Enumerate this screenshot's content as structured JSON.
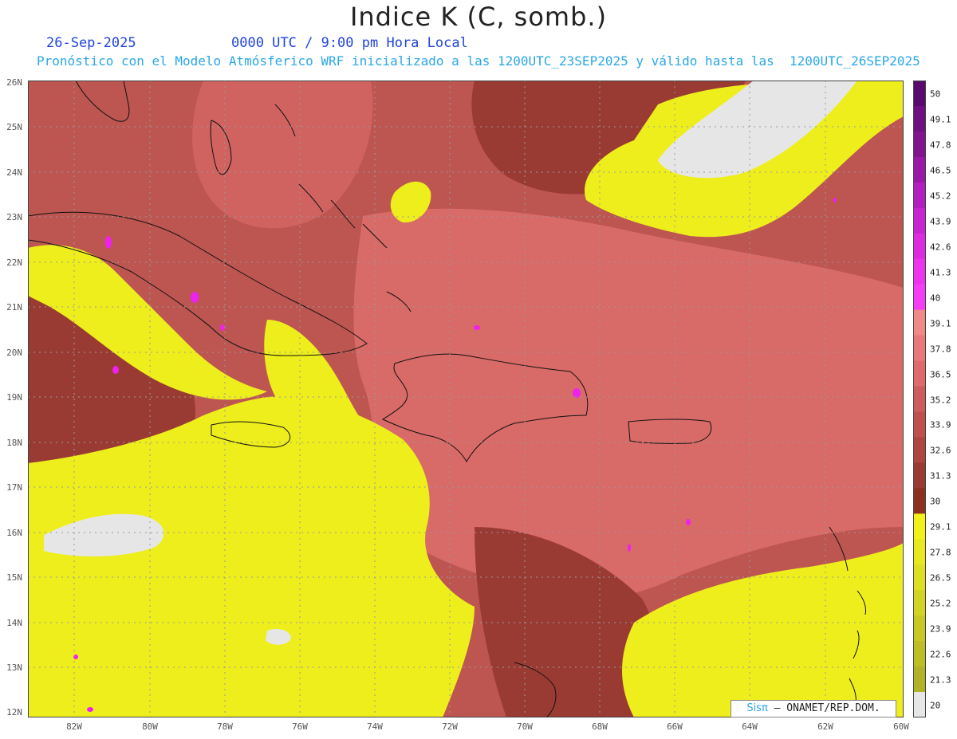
{
  "title": "Indice K (C, somb.)",
  "date_label": "26-Sep-2025",
  "time_label": "0000 UTC / 9:00 pm Hora Local",
  "description": "Pronóstico con el Modelo Atmósferico WRF inicializado a las 1200UTC_23SEP2025 y válido hasta las  1200UTC_26SEP2025",
  "y_axis_labels": [
    "26N",
    "25N",
    "24N",
    "23N",
    "22N",
    "21N",
    "20N",
    "19N",
    "18N",
    "17N",
    "16N",
    "15N",
    "14N",
    "13N",
    "12N"
  ],
  "x_axis_labels": [
    "82W",
    "80W",
    "78W",
    "76W",
    "74W",
    "72W",
    "70W",
    "68W",
    "66W",
    "64W",
    "62W",
    "60W"
  ],
  "colorbar": {
    "labels": [
      "50",
      "49.1",
      "47.8",
      "46.5",
      "45.2",
      "43.9",
      "42.6",
      "41.3",
      "40",
      "39.1",
      "37.8",
      "36.5",
      "35.2",
      "33.9",
      "32.6",
      "31.3",
      "30",
      "29.1",
      "27.8",
      "26.5",
      "25.2",
      "23.9",
      "22.6",
      "21.3",
      "20"
    ],
    "colors": [
      "#5a0a6e",
      "#6e0f82",
      "#82148f",
      "#9a18a8",
      "#b21ebf",
      "#c824d2",
      "#dd2be0",
      "#ee33ee",
      "#f53df7",
      "#f08a86",
      "#e9787a",
      "#df6a6c",
      "#cf5c5c",
      "#bf504e",
      "#ae4540",
      "#9b3a33",
      "#8c3120",
      "#f2f21a",
      "#e8e81e",
      "#dede22",
      "#d3d323",
      "#c8c824",
      "#bdbd25",
      "#b2b226",
      "#e6e6e6"
    ]
  },
  "credit": {
    "brand": "Sisπ",
    "text": "– ONAMET/REP.DOM."
  },
  "map_colors": {
    "low_yellow": "#eeee1c",
    "dark_brown": "#9a3b33",
    "mid_red": "#bd5551",
    "salmon": "#d86a67",
    "magenta": "#ee22ee",
    "grey": "#e6e6e6",
    "coast": "#111111"
  }
}
